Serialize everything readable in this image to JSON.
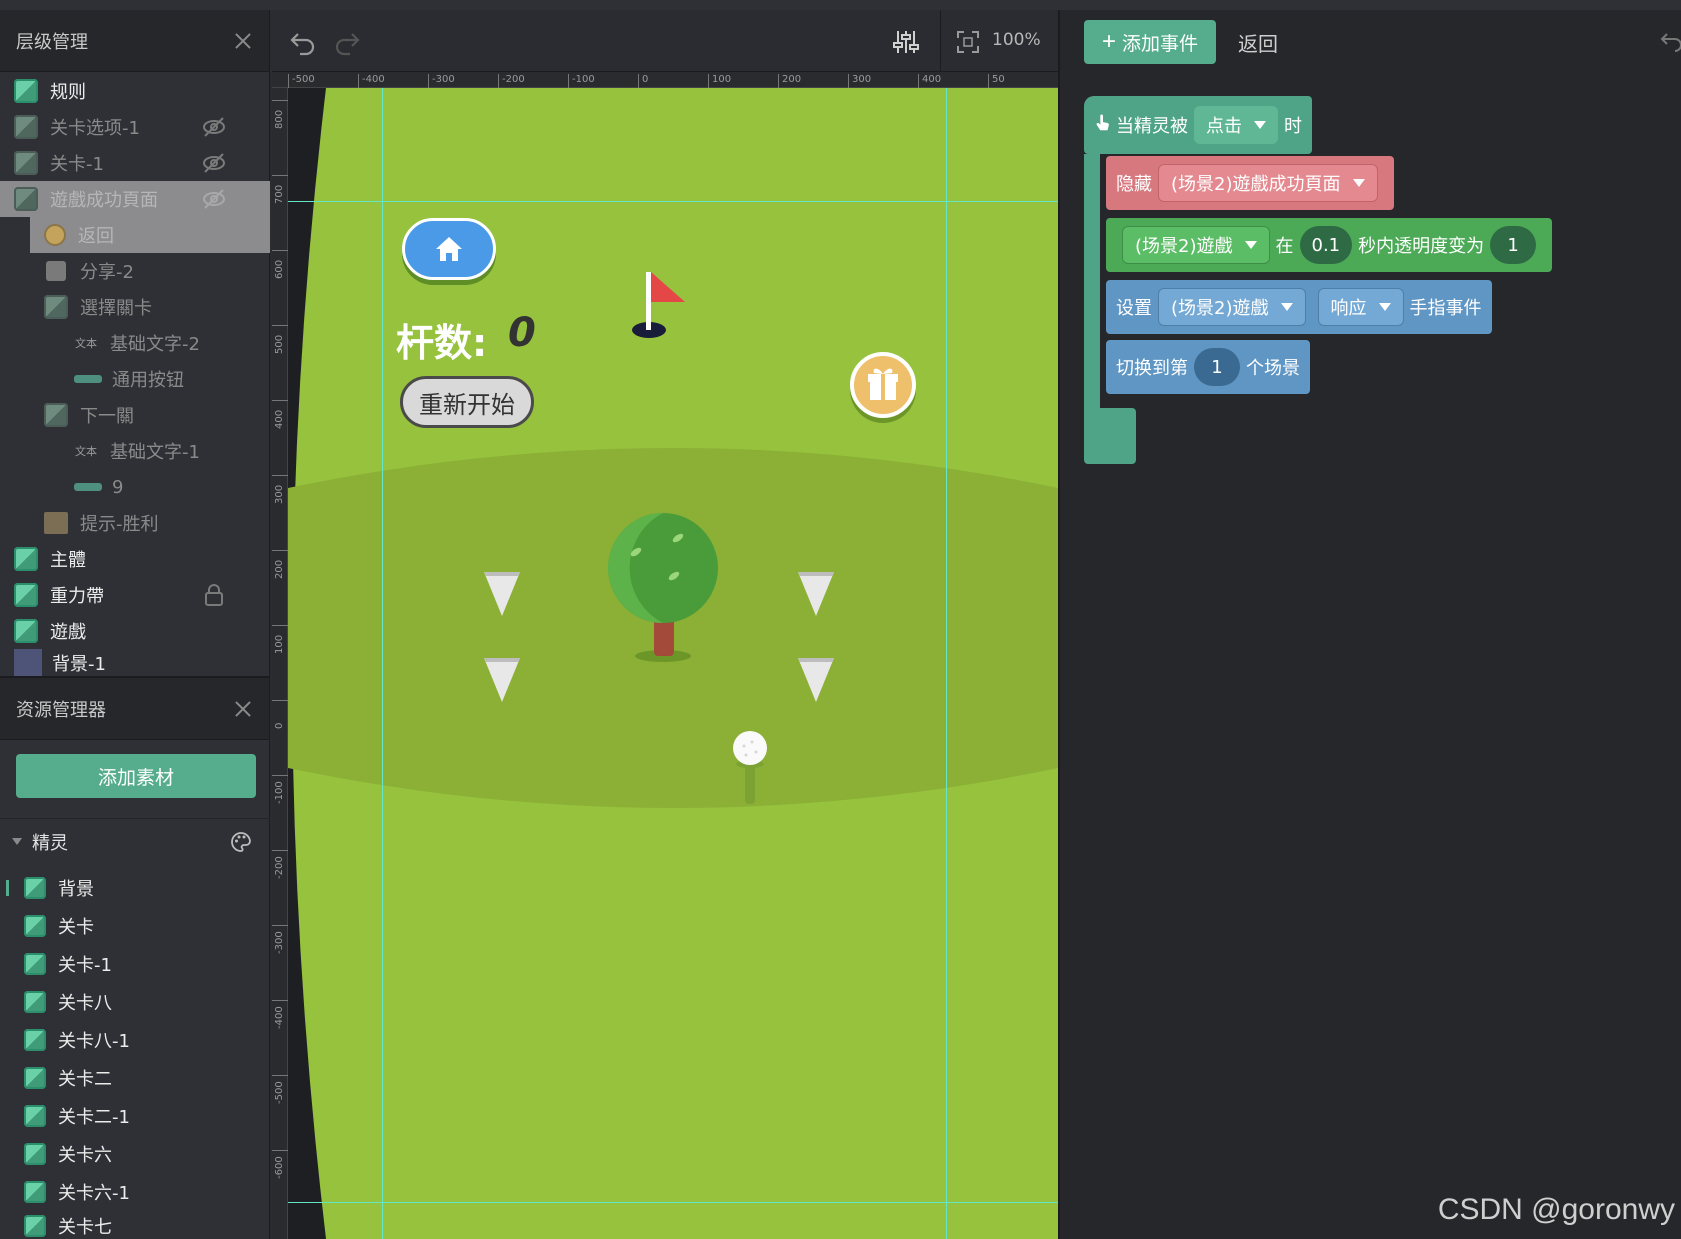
{
  "hierarchy": {
    "title": "层级管理",
    "items": [
      {
        "label": "规则",
        "icon": "cube-icon"
      },
      {
        "label": "关卡选项-1",
        "icon": "cube-icon"
      },
      {
        "label": "关卡-1",
        "icon": "cube-icon"
      },
      {
        "label": "遊戲成功頁面",
        "icon": "cube-icon"
      },
      {
        "label": "返回",
        "icon": "circle-icon"
      },
      {
        "label": "分享-2",
        "icon": "image-icon"
      },
      {
        "label": "選擇關卡",
        "icon": "cube-icon"
      },
      {
        "label": "基础文字-2",
        "icon": "text-icon",
        "icon_text": "文本"
      },
      {
        "label": "通用按钮",
        "icon": "button-icon"
      },
      {
        "label": "下一關",
        "icon": "cube-icon"
      },
      {
        "label": "基础文字-1",
        "icon": "text-icon",
        "icon_text": "文本"
      },
      {
        "label": "9",
        "icon": "button-icon"
      },
      {
        "label": "提示-胜利",
        "icon": "box-icon"
      },
      {
        "label": "主體",
        "icon": "cube-icon"
      },
      {
        "label": "重力帶",
        "icon": "cube-icon"
      },
      {
        "label": "遊戲",
        "icon": "cube-icon"
      },
      {
        "label": "背景-1",
        "icon": "square-icon"
      }
    ]
  },
  "assets": {
    "title": "资源管理器",
    "add_label": "添加素材",
    "group_label": "精灵",
    "items": [
      "背景",
      "关卡",
      "关卡-1",
      "关卡八",
      "关卡八-1",
      "关卡二",
      "关卡二-1",
      "关卡六",
      "关卡六-1",
      "关卡七"
    ]
  },
  "toolbar": {
    "zoom": "100%"
  },
  "ruler": {
    "top": [
      "-500",
      "-400",
      "-300",
      "-200",
      "-100",
      "0",
      "100",
      "200",
      "300",
      "400",
      "50"
    ],
    "left": [
      "800",
      "700",
      "600",
      "500",
      "400",
      "300",
      "200",
      "100",
      "0",
      "-100",
      "-200",
      "-300",
      "-400",
      "-500",
      "-600"
    ]
  },
  "game": {
    "strokes_label": "杆数:",
    "strokes_value": "0",
    "restart_label": "重新开始"
  },
  "editor": {
    "add_event_label": "添加事件",
    "back_label": "返回",
    "event": {
      "prefix": "当精灵被",
      "trigger": "点击",
      "suffix": "时"
    },
    "hide_block": {
      "label": "隐藏",
      "target": "(场景2)遊戲成功頁面"
    },
    "fade_block": {
      "target": "(场景2)遊戲",
      "in_label": "在",
      "seconds": "0.1",
      "mid_label": "秒内透明度变为",
      "opacity": "1"
    },
    "set_block": {
      "label": "设置",
      "target": "(场景2)遊戲",
      "mode": "响应",
      "suffix": "手指事件"
    },
    "switch_block": {
      "prefix": "切换到第",
      "index": "1",
      "suffix": "个场景"
    }
  },
  "watermark": "CSDN @goronwy",
  "colors": {
    "accent": "#56ad8d",
    "hide_block": "#d7787f",
    "fade_block": "#4caa57",
    "set_block": "#5f96c4",
    "grass": "#96c23e"
  }
}
